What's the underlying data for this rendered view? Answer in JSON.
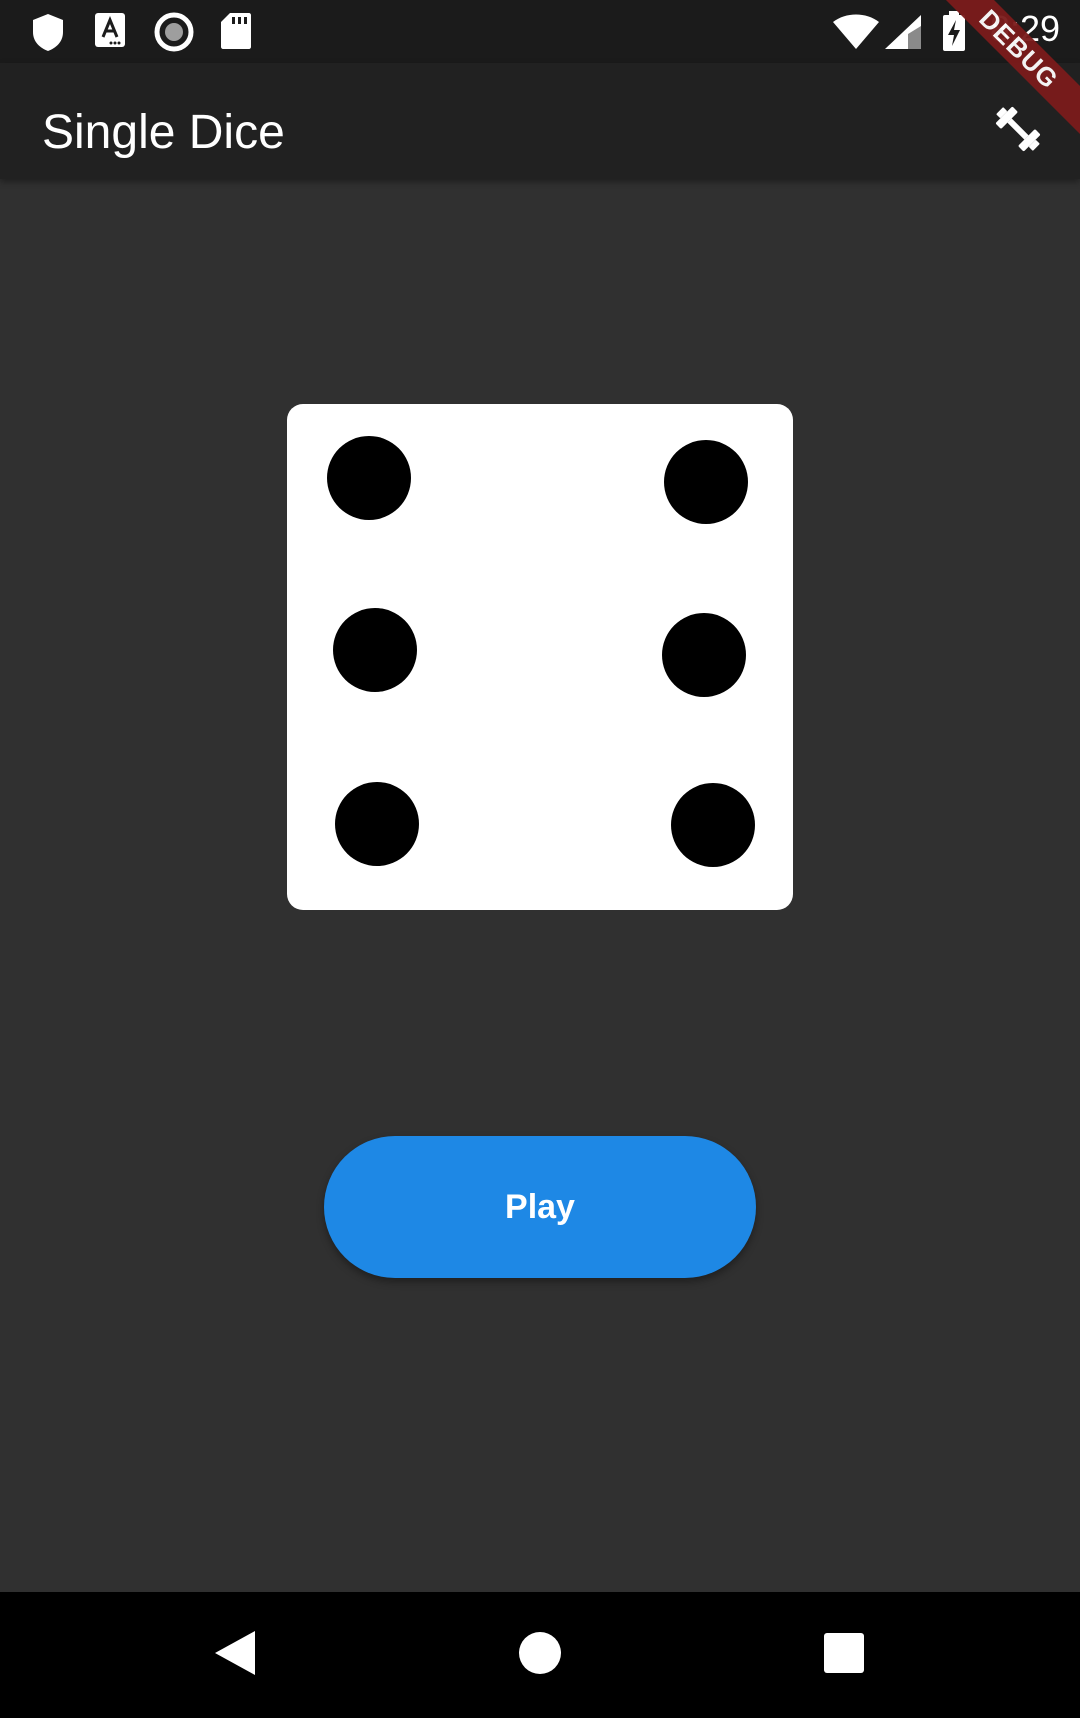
{
  "status_bar": {
    "time": "8:29",
    "left_icons": [
      "shield-icon",
      "font-a-icon",
      "record-icon",
      "sd-card-icon"
    ],
    "right_icons": [
      "wifi-icon",
      "signal-icon",
      "battery-charging-icon"
    ]
  },
  "app_bar": {
    "title": "Single Dice",
    "action_icon": "dumbbell-icon"
  },
  "debug_banner": {
    "label": "DEBUG",
    "color": "#7b1b1b"
  },
  "dice": {
    "value": 6,
    "face_color": "#ffffff",
    "pip_color": "#000000"
  },
  "play_button": {
    "label": "Play",
    "color": "#1e88e5"
  },
  "nav_bar": {
    "buttons": [
      "back-icon",
      "home-icon",
      "recents-icon"
    ]
  },
  "colors": {
    "background": "#303030",
    "app_bar": "#212121",
    "status_bar": "#1b1b1b"
  }
}
